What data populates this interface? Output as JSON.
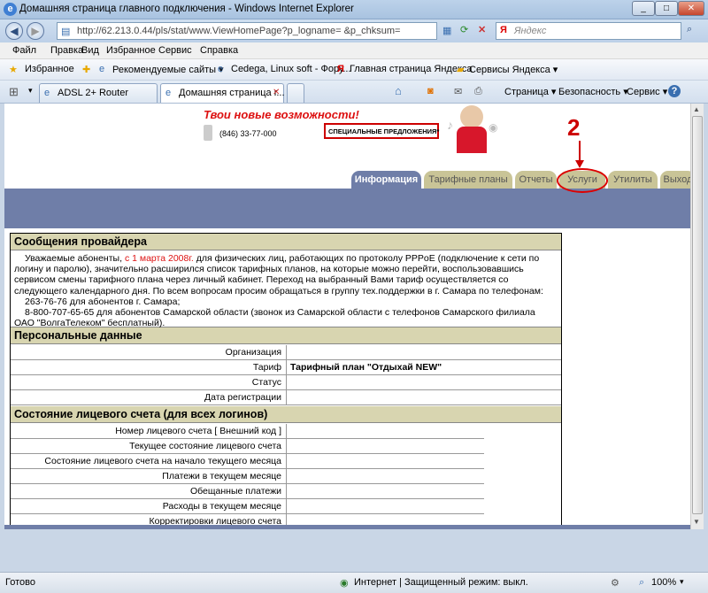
{
  "window": {
    "title": "Домашняя страница главного подключения - Windows Internet Explorer",
    "min_icon": "minimize-icon",
    "max_icon": "maximize-icon",
    "close_label": "✕"
  },
  "address": {
    "url": "http://62.213.0.44/pls/stat/www.ViewHomePage?p_logname=            &p_chksum=",
    "search_placeholder": "Яндекс",
    "search_logo": "Я"
  },
  "menu": [
    "Файл",
    "Правка",
    "Вид",
    "Избранное",
    "Сервис",
    "Справка"
  ],
  "favorites": {
    "label": "Избранное",
    "items": [
      "Рекомендуемые сайты ▾",
      "Cedega, Linux soft - Фору...",
      "Главная страница Яндекса",
      "Сервисы Яндекса ▾"
    ]
  },
  "browser_tabs": [
    {
      "label": "ADSL 2+ Router"
    },
    {
      "label": "Домашняя страница г..."
    }
  ],
  "command_bar": [
    "Страница ▾",
    "Безопасность ▾",
    "Сервис ▾"
  ],
  "banner": {
    "headline": "Твои новые возможности!",
    "phone": "(846) 33-77-000",
    "button": "СПЕЦИАЛЬНЫЕ ПРЕДЛОЖЕНИЯ*"
  },
  "site_tabs": [
    "Информация",
    "Тарифные планы",
    "Отчеты",
    "Услуги",
    "Утилиты",
    "Выход"
  ],
  "annotation": {
    "number": "2"
  },
  "sections": {
    "messages": "Сообщения провайдера",
    "personal": "Персональные данные",
    "account": "Состояние лицевого счета (для всех логинов)"
  },
  "message": {
    "line1_a": "Уважаемые абоненты, ",
    "line1_date": "с 1 марта 2008г.",
    "line1_b": " для физических лиц, работающих по протоколу PPPoE (подключение к сети по логину и паролю), значительно расширился список тарифных планов, на которые можно перейти, воспользовавшись сервисом смены тарифного плана через личный кабинет. Переход на выбранный Вами тариф осуществляется со следующего календарного дня. По всем вопросам просим обращаться в группу тех.поддержки в г. Самара по телефонам:",
    "line2": "263-76-76 для абонентов г. Самара;",
    "line3": "8-800-707-65-65 для абонентов Самарской области (звонок из Самарской области с телефонов Самарского филиала ОАО \"ВолгаТелеком\" бесплатный)."
  },
  "personal_rows": [
    {
      "label": "Организация",
      "value": ""
    },
    {
      "label": "Тариф",
      "value": "Тарифный план \"Отдыхай NEW\""
    },
    {
      "label": "Статус",
      "value": ""
    },
    {
      "label": "Дата регистрации",
      "value": ""
    }
  ],
  "account_rows": [
    {
      "label": "Номер лицевого счета   [ Внешний код ]"
    },
    {
      "label": "Текущее состояние лицевого счета"
    },
    {
      "label": "Состояние лицевого счета на начало текущего месяца"
    },
    {
      "label": "Платежи в текущем месяце"
    },
    {
      "label": "Обещанные платежи"
    },
    {
      "label": "Расходы в текущем месяце"
    },
    {
      "label": "Корректировки лицевого счета"
    }
  ],
  "status": {
    "left": "Готово",
    "zone": "Интернет | Защищенный режим: выкл.",
    "zoom": "100%"
  }
}
